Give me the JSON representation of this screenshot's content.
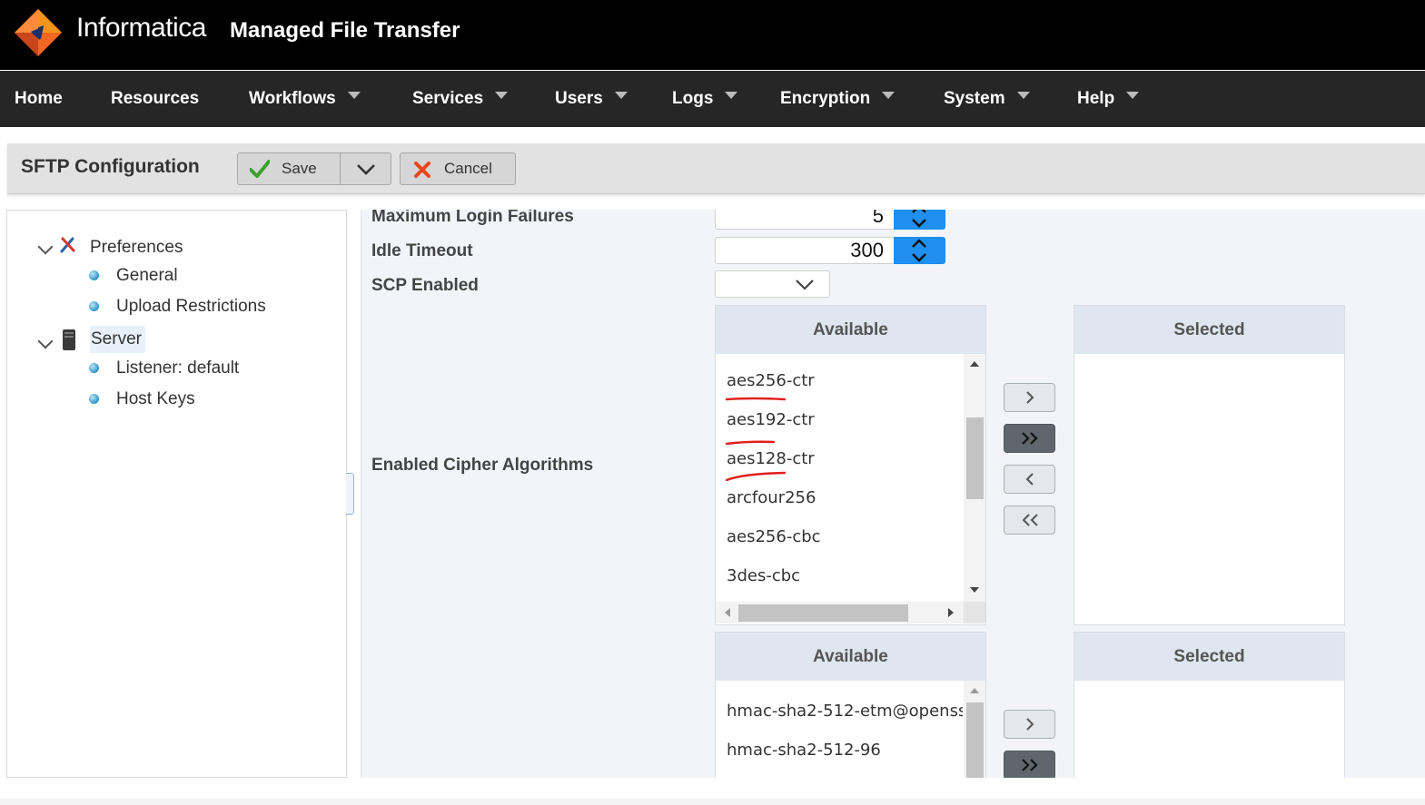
{
  "header": {
    "brand": "Informatica",
    "product": "Managed File Transfer"
  },
  "nav": {
    "items": [
      {
        "label": "Home"
      },
      {
        "label": "Resources"
      },
      {
        "label": "Workflows"
      },
      {
        "label": "Services"
      },
      {
        "label": "Users"
      },
      {
        "label": "Logs"
      },
      {
        "label": "Encryption"
      },
      {
        "label": "System"
      },
      {
        "label": "Help"
      }
    ]
  },
  "toolbar": {
    "title": "SFTP Configuration",
    "save_label": "Save",
    "cancel_label": "Cancel"
  },
  "tree": {
    "preferences": "Preferences",
    "general": "General",
    "upload_restrictions": "Upload Restrictions",
    "server": "Server",
    "listener": "Listener: default",
    "host_keys": "Host Keys"
  },
  "form": {
    "max_login_failures": {
      "label": "Maximum Login Failures",
      "value": "5"
    },
    "idle_timeout": {
      "label": "Idle Timeout",
      "value": "300"
    },
    "scp_enabled": {
      "label": "SCP Enabled",
      "value": ""
    },
    "cipher": {
      "label": "Enabled Cipher Algorithms",
      "available_header": "Available",
      "selected_header": "Selected",
      "available": [
        "aes256-ctr",
        "aes192-ctr",
        "aes128-ctr",
        "arcfour256",
        "aes256-cbc",
        "3des-cbc"
      ]
    },
    "mac": {
      "available_header": "Available",
      "selected_header": "Selected",
      "available": [
        "hmac-sha2-512-etm@openss",
        "hmac-sha2-512-96"
      ]
    }
  },
  "colors": {
    "accent_blue": "#1f8ff0",
    "annotation_red": "#e0201b",
    "nav_bg": "#262626"
  }
}
